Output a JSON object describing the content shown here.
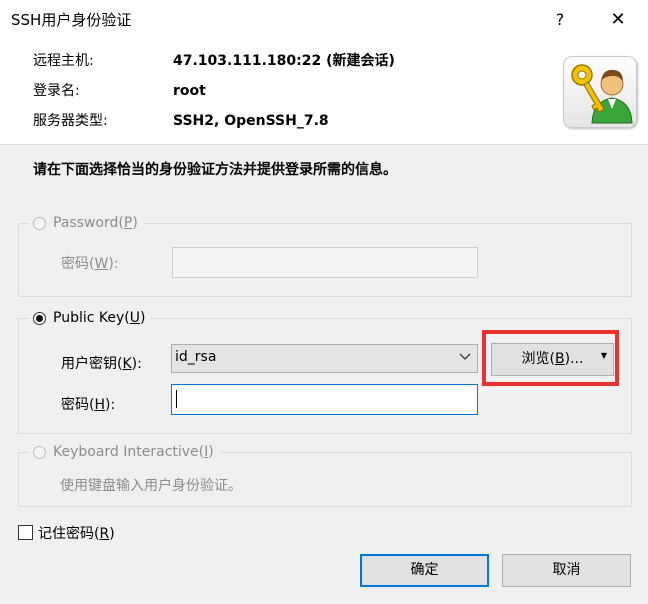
{
  "window": {
    "title": "SSH用户身份验证",
    "help_glyph": "?",
    "close_glyph": "✕"
  },
  "info": {
    "host_label": "远程主机:",
    "host_value": "47.103.111.180:22 (新建会话)",
    "user_label": "登录名:",
    "user_value": "root",
    "server_label": "服务器类型:",
    "server_value": "SSH2, OpenSSH_7.8",
    "logo_icon": "key-user-icon"
  },
  "instruction": "请在下面选择恰当的身份验证方法并提供登录所需的信息。",
  "password_group": {
    "radio_label": "Password(",
    "radio_mnemonic": "P",
    "radio_suffix": ")",
    "field_label": "密码(",
    "field_mnemonic": "W",
    "field_suffix": "):",
    "selected": false,
    "enabled": false
  },
  "publickey_group": {
    "radio_label": "Public Key(",
    "radio_mnemonic": "U",
    "radio_suffix": ")",
    "selected": true,
    "key_label": "用户密钥(",
    "key_mnemonic": "K",
    "key_suffix": "):",
    "key_value": "id_rsa",
    "browse_label": "浏览(",
    "browse_mnemonic": "B",
    "browse_suffix": ")...",
    "pass_label": "密码(",
    "pass_mnemonic": "H",
    "pass_suffix": "):",
    "pass_value": ""
  },
  "keyboard_group": {
    "radio_label": "Keyboard Interactive(",
    "radio_mnemonic": "I",
    "radio_suffix": ")",
    "description": "使用键盘输入用户身份验证。",
    "selected": false,
    "enabled": false
  },
  "remember": {
    "label": "记住密码(",
    "mnemonic": "R",
    "suffix": ")",
    "checked": false
  },
  "buttons": {
    "ok": "确定",
    "cancel": "取消"
  },
  "colors": {
    "highlight": "#e8322f",
    "focus": "#0078d7"
  }
}
